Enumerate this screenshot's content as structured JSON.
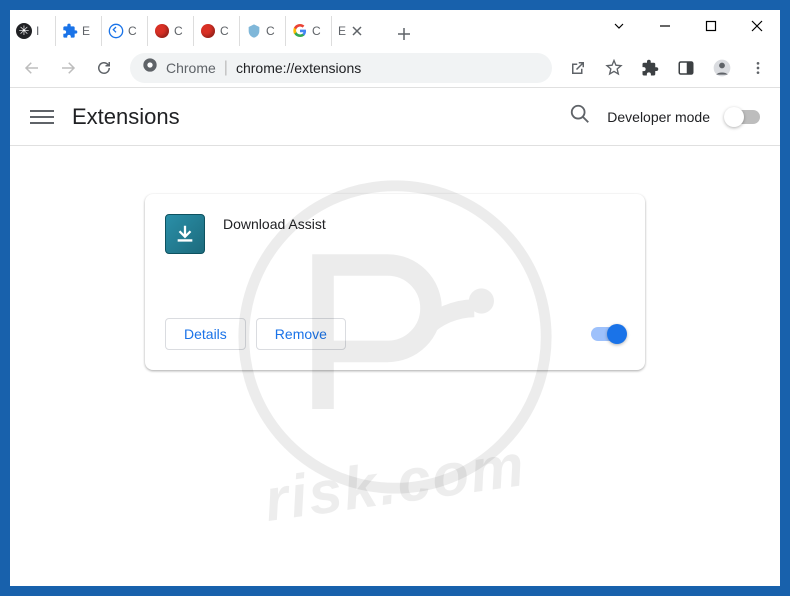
{
  "tabs": [
    {
      "label": "I"
    },
    {
      "label": "E"
    },
    {
      "label": "C"
    },
    {
      "label": "C"
    },
    {
      "label": "C"
    },
    {
      "label": "C"
    },
    {
      "label": "C"
    },
    {
      "label": "E"
    }
  ],
  "omnibox": {
    "prefix": "Chrome",
    "separator": "|",
    "path": "chrome://extensions"
  },
  "header": {
    "title": "Extensions",
    "devmode_label": "Developer mode"
  },
  "extension": {
    "name": "Download Assist",
    "details_label": "Details",
    "remove_label": "Remove"
  },
  "watermark_text": "risk.com"
}
